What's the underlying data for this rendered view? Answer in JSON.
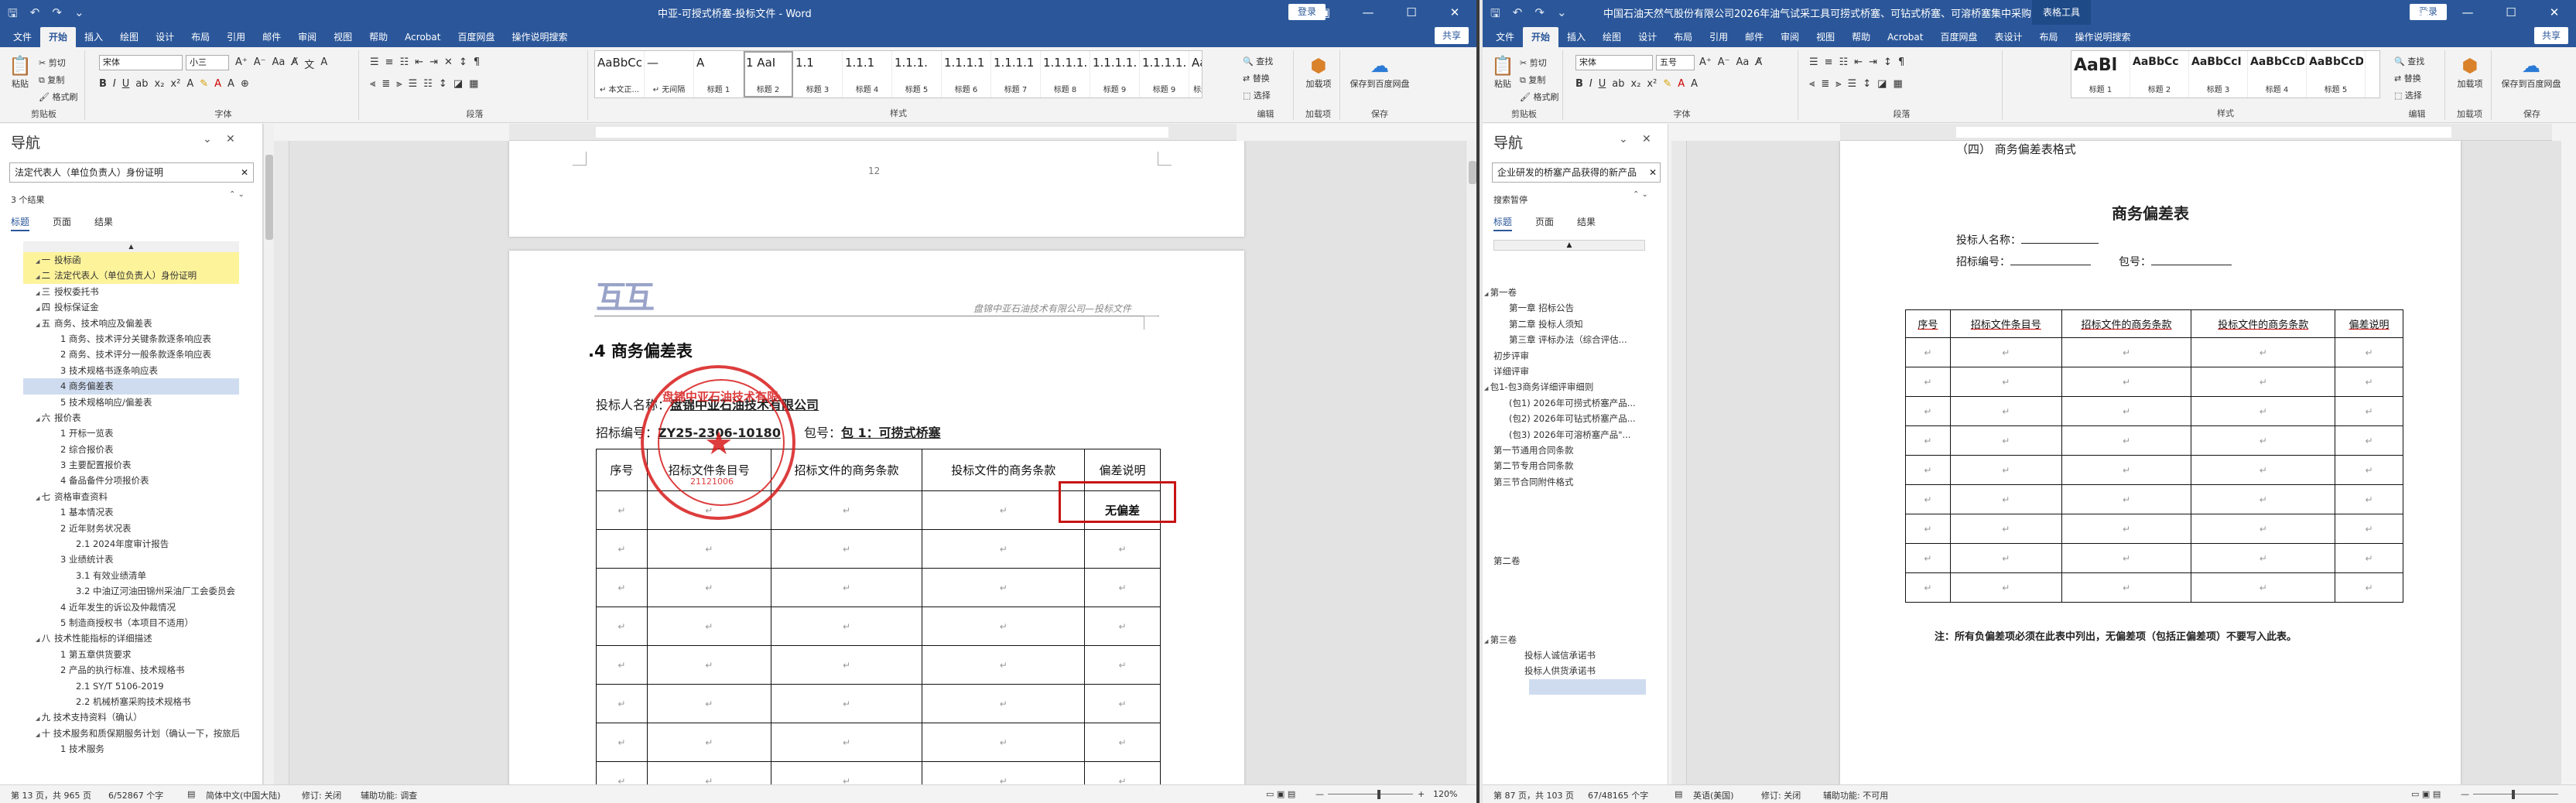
{
  "w1": {
    "title": "中亚-可授式桥塞-投标文件 - Word",
    "signin": "登录",
    "share": "共享",
    "tabs": [
      "文件",
      "开始",
      "插入",
      "绘图",
      "设计",
      "布局",
      "引用",
      "邮件",
      "审阅",
      "视图",
      "帮助",
      "Acrobat",
      "百度网盘",
      "操作说明搜索"
    ],
    "clipboard": {
      "paste": "粘贴",
      "cut": "剪切",
      "copy": "复制",
      "painter": "格式刷",
      "group": "剪贴板"
    },
    "font": {
      "name": "宋体",
      "size": "小三",
      "group": "字体"
    },
    "paragraph_group": "段落",
    "styles": [
      {
        "preview": "AaBbCcDd",
        "name": "↵ 本文正..."
      },
      {
        "preview": "—",
        "name": "↵ 无间隔"
      },
      {
        "preview": "A",
        "name": "标题 1"
      },
      {
        "preview": "1 AaI",
        "name": "标题 2"
      },
      {
        "preview": "1.1",
        "name": "标题 3"
      },
      {
        "preview": "1.1.1",
        "name": "标题 4"
      },
      {
        "preview": "1.1.1.",
        "name": "标题 5"
      },
      {
        "preview": "1.1.1.1",
        "name": "标题 6"
      },
      {
        "preview": "1.1.1.1",
        "name": "标题 7"
      },
      {
        "preview": "1.1.1.1.",
        "name": "标题 8"
      },
      {
        "preview": "1.1.1.1.",
        "name": "标题 9"
      },
      {
        "preview": "1.1.1.1.",
        "name": "标题 9"
      },
      {
        "preview": "AaBbC",
        "name": "标题 字符 1"
      }
    ],
    "styles_group": "样式",
    "editing": {
      "find": "查找",
      "replace": "替换",
      "select": "选择",
      "group": "编辑"
    },
    "addins": {
      "label": "加载项",
      "sub": "加载项",
      "group": "加载项"
    },
    "save": {
      "label": "保存到百度网盘",
      "group": "保存"
    },
    "nav": {
      "title": "导航",
      "search": "法定代表人（单位负责人）身份证明",
      "results": "3 个结果",
      "tabs": [
        "标题",
        "页面",
        "结果"
      ],
      "items": [
        {
          "text": "投标函",
          "hl": true,
          "indent": 0
        },
        {
          "text": "法定代表人（单位负责人）身份证明",
          "hl": true,
          "indent": 0
        },
        {
          "text": "授权委托书",
          "indent": 0
        },
        {
          "text": "投标保证金",
          "indent": 0
        },
        {
          "text": "商务、技术响应及偏差表",
          "indent": 0
        },
        {
          "text": "1 商务、技术评分关键条款逐条响应表",
          "indent": 1
        },
        {
          "text": "2 商务、技术评分一般条款逐条响应表",
          "indent": 1
        },
        {
          "text": "3 技术规格书逐条响应表",
          "indent": 1
        },
        {
          "text": "4 商务偏差表",
          "indent": 1,
          "sel": true
        },
        {
          "text": "5 技术规格响应/偏差表",
          "indent": 1
        },
        {
          "text": "报价表",
          "indent": 0
        },
        {
          "text": "1 开标一览表",
          "indent": 1
        },
        {
          "text": "2 综合报价表",
          "indent": 1
        },
        {
          "text": "3 主要配置报价表",
          "indent": 1
        },
        {
          "text": "4 备品备件分项报价表",
          "indent": 1
        },
        {
          "text": "资格审查资料",
          "indent": 0
        },
        {
          "text": "1 基本情况表",
          "indent": 1
        },
        {
          "text": "2 近年财务状况表",
          "indent": 1
        },
        {
          "text": "2.1 2024年度审计报告",
          "indent": 2
        },
        {
          "text": "3 业绩统计表",
          "indent": 1
        },
        {
          "text": "3.1 有效业绩清单",
          "indent": 2
        },
        {
          "text": "3.2 中油辽河油田锦州采油厂工会委员会",
          "indent": 2
        },
        {
          "text": "4 近年发生的诉讼及仲裁情况",
          "indent": 1
        },
        {
          "text": "5 制造商授权书（本项目不适用）",
          "indent": 1
        },
        {
          "text": "技术性能指标的详细描述",
          "indent": 0
        },
        {
          "text": "1 第五章供货要求",
          "indent": 1
        },
        {
          "text": "2 产品的执行标准、技术规格书",
          "indent": 1
        },
        {
          "text": "2.1 SY/T 5106-2019",
          "indent": 2
        },
        {
          "text": "2.2 机械桥塞采购技术规格书",
          "indent": 2
        },
        {
          "text": "九 技术支持资料（确认）",
          "indent": 0
        },
        {
          "text": "十 技术服务和质保期服务计划（确认一下，按旅后...",
          "indent": 0
        },
        {
          "text": "1 技术服务",
          "indent": 1
        }
      ],
      "prefixes": [
        "一",
        "二",
        "三",
        "四",
        "五",
        "",
        "",
        "",
        "",
        "",
        "六",
        "",
        "",
        "",
        "",
        "七",
        "",
        "",
        "",
        "",
        "",
        "",
        "",
        "",
        "八",
        "",
        "",
        "",
        "",
        "",
        ""
      ]
    },
    "page_no": "12",
    "header_company": "盘锦中亚石油技术有限公司—投标文件",
    "heading": ".4 商务偏差表",
    "bidder_label": "投标人名称：",
    "bidder": "盘锦中亚石油技术有限公司",
    "bidno_label": "招标编号：",
    "bidno": "ZY25-2306-10180",
    "pkg_label": "包号：",
    "pkg": "包 1：可捞式桥塞",
    "table_headers": [
      "序号",
      "招标文件条目号",
      "招标文件的商务条款",
      "投标文件的商务条款",
      "偏差说明"
    ],
    "no_dev": "无偏差",
    "stamp": "盘锦中亚石油技术有限公司",
    "stamp_no": "21121006",
    "status": {
      "page": "第 13 页，共 965 页",
      "words": "6/52867 个字",
      "lang": "简体中文(中国大陆)",
      "track": "修订: 关闭",
      "access": "辅助功能: 调查",
      "zoom": "120%"
    }
  },
  "w2": {
    "title": "中国石油天然气股份有限公司2026年油气试采工具可捞式桥塞、可钻式桥塞、可溶桥塞集中采购（京...",
    "ctx": "表格工具",
    "signin": "登录",
    "share": "共享",
    "tabs": [
      "文件",
      "开始",
      "插入",
      "绘图",
      "设计",
      "布局",
      "引用",
      "邮件",
      "审阅",
      "视图",
      "帮助",
      "Acrobat",
      "百度网盘",
      "表设计",
      "布局",
      "操作说明搜索"
    ],
    "clipboard": {
      "paste": "粘贴",
      "cut": "剪切",
      "copy": "复制",
      "painter": "格式刷",
      "group": "剪贴板"
    },
    "font": {
      "name": "宋体",
      "size": "五号",
      "group": "字体"
    },
    "paragraph_group": "段落",
    "styles": [
      {
        "preview": "AaBl",
        "name": "标题 1"
      },
      {
        "preview": "AaBbCc",
        "name": "标题 2"
      },
      {
        "preview": "AaBbCcI",
        "name": "标题 3"
      },
      {
        "preview": "AaBbCcDc",
        "name": "标题 4"
      },
      {
        "preview": "AaBbCcDd",
        "name": "标题 5"
      }
    ],
    "styles_group": "样式",
    "editing": {
      "find": "查找",
      "replace": "替换",
      "select": "选择",
      "group": "编辑"
    },
    "addins": {
      "label": "加载项",
      "sub": "加载项",
      "group": "加载项"
    },
    "save": {
      "label": "保存到百度网盘",
      "group": "保存"
    },
    "nav": {
      "title": "导航",
      "search": "企业研发的桥塞产品获得的新产品",
      "results": "搜索暂停",
      "tabs": [
        "标题",
        "页面",
        "结果"
      ],
      "items": [
        {
          "text": "第一卷",
          "indent": 0,
          "arrow": true
        },
        {
          "text": "第一章  招标公告",
          "indent": 1
        },
        {
          "text": "第二章  投标人须知",
          "indent": 1
        },
        {
          "text": "第三章  评标办法（综合评估...",
          "indent": 1
        },
        {
          "text": "初步评审",
          "indent": 0
        },
        {
          "text": "详细评审",
          "indent": 0
        },
        {
          "text": "包1-包3商务详细评审细则",
          "indent": 0,
          "arrow": true
        },
        {
          "text": "(包1) 2026年可捞式桥塞产品...",
          "indent": 1
        },
        {
          "text": "(包2) 2026年可钻式桥塞产品...",
          "indent": 1
        },
        {
          "text": "(包3) 2026年可溶桥塞产品\"...",
          "indent": 1
        },
        {
          "text": "第一节通用合同条款",
          "indent": 0
        },
        {
          "text": "第二节专用合同条款",
          "indent": 0
        },
        {
          "text": "第三节合同附件格式",
          "indent": 0
        },
        {
          "text": "",
          "indent": 0
        },
        {
          "text": "",
          "indent": 0
        },
        {
          "text": "",
          "indent": 0
        },
        {
          "text": "",
          "indent": 0
        },
        {
          "text": "第二卷",
          "indent": 0
        },
        {
          "text": "",
          "indent": 0
        },
        {
          "text": "",
          "indent": 0
        },
        {
          "text": "",
          "indent": 0
        },
        {
          "text": "",
          "indent": 0
        },
        {
          "text": "第三卷",
          "indent": 0,
          "arrow": true
        },
        {
          "text": "投标人诚信承诺书",
          "indent": 2
        },
        {
          "text": "投标人供货承诺书",
          "indent": 2
        },
        {
          "text": "",
          "indent": 2,
          "sel": true
        }
      ]
    },
    "top_heading": "（四）  商务偏差表格式",
    "title_cn": "商务偏差表",
    "bidder_label": "投标人名称：",
    "bidno_label": "招标编号：",
    "pkg_label": "包号：",
    "table_headers": [
      "序号",
      "招标文件条目号",
      "招标文件的商务条款",
      "投标文件的商务条款",
      "偏差说明"
    ],
    "note": "注：所有负偏差项必须在此表中列出，无偏差项（包括正偏差项）不要写入此表。",
    "status": {
      "page": "第 87 页，共 103 页",
      "words": "67/48165 个字",
      "lang": "英语(美国)",
      "track": "修订: 关闭",
      "access": "辅助功能: 不可用"
    }
  }
}
